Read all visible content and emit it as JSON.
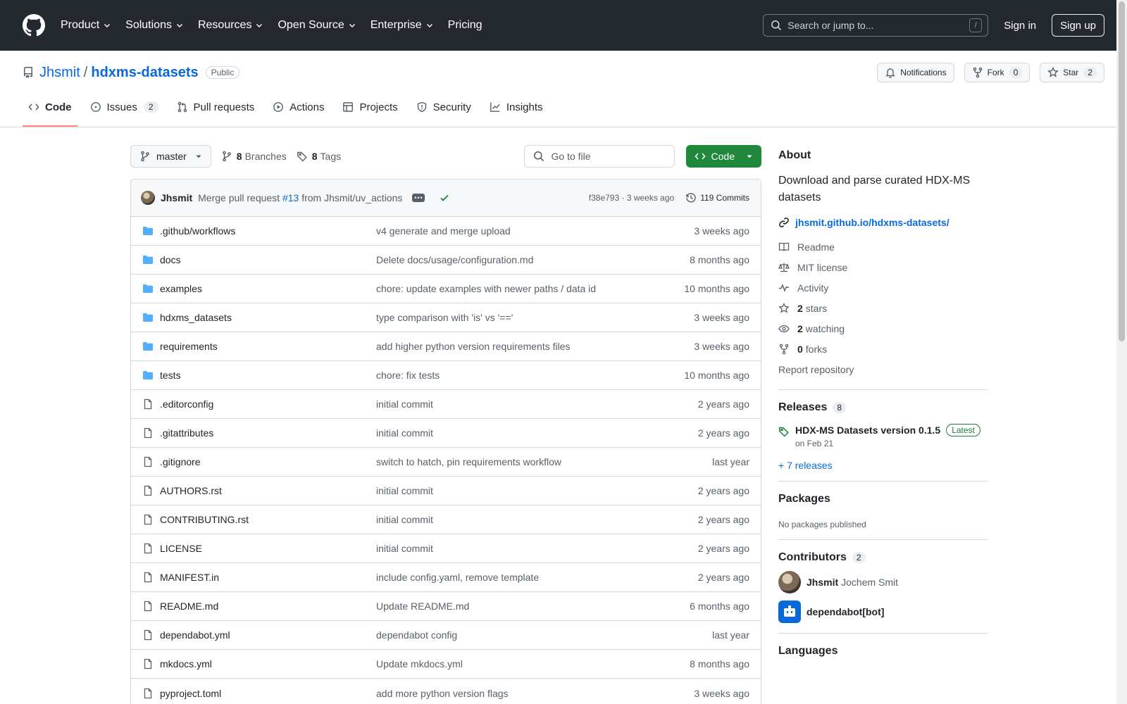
{
  "header": {
    "nav": [
      {
        "label": "Product",
        "dropdown": true
      },
      {
        "label": "Solutions",
        "dropdown": true
      },
      {
        "label": "Resources",
        "dropdown": true
      },
      {
        "label": "Open Source",
        "dropdown": true
      },
      {
        "label": "Enterprise",
        "dropdown": true
      },
      {
        "label": "Pricing",
        "dropdown": false
      }
    ],
    "search_placeholder": "Search or jump to...",
    "search_key": "/",
    "sign_in": "Sign in",
    "sign_up": "Sign up"
  },
  "repo": {
    "owner": "Jhsmit",
    "separator": "/",
    "name": "hdxms-datasets",
    "visibility": "Public",
    "notifications_label": "Notifications",
    "fork_label": "Fork",
    "fork_count": "0",
    "star_label": "Star",
    "star_count": "2"
  },
  "tabs": [
    {
      "label": "Code",
      "icon": "code-icon",
      "active": true,
      "count": ""
    },
    {
      "label": "Issues",
      "icon": "issue-icon",
      "active": false,
      "count": "2"
    },
    {
      "label": "Pull requests",
      "icon": "pull-request-icon",
      "active": false,
      "count": ""
    },
    {
      "label": "Actions",
      "icon": "play-icon",
      "active": false,
      "count": ""
    },
    {
      "label": "Projects",
      "icon": "table-icon",
      "active": false,
      "count": ""
    },
    {
      "label": "Security",
      "icon": "shield-icon",
      "active": false,
      "count": ""
    },
    {
      "label": "Insights",
      "icon": "graph-icon",
      "active": false,
      "count": ""
    }
  ],
  "file_nav": {
    "branch": "master",
    "branches_count": "8",
    "branches_label": "Branches",
    "tags_count": "8",
    "tags_label": "Tags",
    "goto_placeholder": "Go to file",
    "code_button": "Code"
  },
  "commit": {
    "author": "Jhsmit",
    "message_prefix": "Merge pull request",
    "pr": "#13",
    "message_suffix": "from Jhsmit/uv_actions",
    "sha_time": "f38e793 · 3 weeks ago",
    "commits_label": "119 Commits"
  },
  "files": [
    {
      "name": ".github/workflows",
      "type": "dir",
      "message": "v4 generate and merge upload",
      "time": "3 weeks ago"
    },
    {
      "name": "docs",
      "type": "dir",
      "message": "Delete docs/usage/configuration.md",
      "time": "8 months ago"
    },
    {
      "name": "examples",
      "type": "dir",
      "message": "chore: update examples with newer paths / data id",
      "time": "10 months ago"
    },
    {
      "name": "hdxms_datasets",
      "type": "dir",
      "message": "type comparison with 'is' vs '=='",
      "time": "3 weeks ago"
    },
    {
      "name": "requirements",
      "type": "dir",
      "message": "add higher python version requirements files",
      "time": "3 weeks ago"
    },
    {
      "name": "tests",
      "type": "dir",
      "message": "chore: fix tests",
      "time": "10 months ago"
    },
    {
      "name": ".editorconfig",
      "type": "file",
      "message": "initial commit",
      "time": "2 years ago"
    },
    {
      "name": ".gitattributes",
      "type": "file",
      "message": "initial commit",
      "time": "2 years ago"
    },
    {
      "name": ".gitignore",
      "type": "file",
      "message": "switch to hatch, pin requirements workflow",
      "time": "last year"
    },
    {
      "name": "AUTHORS.rst",
      "type": "file",
      "message": "initial commit",
      "time": "2 years ago"
    },
    {
      "name": "CONTRIBUTING.rst",
      "type": "file",
      "message": "initial commit",
      "time": "2 years ago"
    },
    {
      "name": "LICENSE",
      "type": "file",
      "message": "initial commit",
      "time": "2 years ago"
    },
    {
      "name": "MANIFEST.in",
      "type": "file",
      "message": "include config.yaml, remove template",
      "time": "2 years ago"
    },
    {
      "name": "README.md",
      "type": "file",
      "message": "Update README.md",
      "time": "6 months ago"
    },
    {
      "name": "dependabot.yml",
      "type": "file",
      "message": "dependabot config",
      "time": "last year"
    },
    {
      "name": "mkdocs.yml",
      "type": "file",
      "message": "Update mkdocs.yml",
      "time": "8 months ago"
    },
    {
      "name": "pyproject.toml",
      "type": "file",
      "message": "add more python version flags",
      "time": "3 weeks ago"
    }
  ],
  "about": {
    "heading": "About",
    "description": "Download and parse curated HDX-MS datasets",
    "link": "jhsmit.github.io/hdxms-datasets/",
    "items": [
      {
        "icon": "book-icon",
        "bold": "",
        "label": "Readme"
      },
      {
        "icon": "law-icon",
        "bold": "",
        "label": "MIT license"
      },
      {
        "icon": "pulse-icon",
        "bold": "",
        "label": "Activity"
      },
      {
        "icon": "star-icon",
        "bold": "2",
        "label": "stars"
      },
      {
        "icon": "eye-icon",
        "bold": "2",
        "label": "watching"
      },
      {
        "icon": "fork-icon",
        "bold": "0",
        "label": "forks"
      }
    ],
    "report": "Report repository"
  },
  "releases": {
    "heading": "Releases",
    "count": "8",
    "title": "HDX-MS Datasets version 0.1.5",
    "badge": "Latest",
    "date": "on Feb 21",
    "more": "+ 7 releases"
  },
  "packages": {
    "heading": "Packages",
    "empty": "No packages published"
  },
  "contributors": {
    "heading": "Contributors",
    "count": "2",
    "list": [
      {
        "login": "Jhsmit",
        "name": "Jochem Smit"
      },
      {
        "login": "dependabot[bot]",
        "name": ""
      }
    ]
  },
  "languages": {
    "heading": "Languages"
  },
  "colors": {
    "header_bg": "#24292f",
    "link": "#0969da",
    "code_button": "#1f883d",
    "folder": "#54aeff",
    "active_tab": "#fd8c73"
  }
}
